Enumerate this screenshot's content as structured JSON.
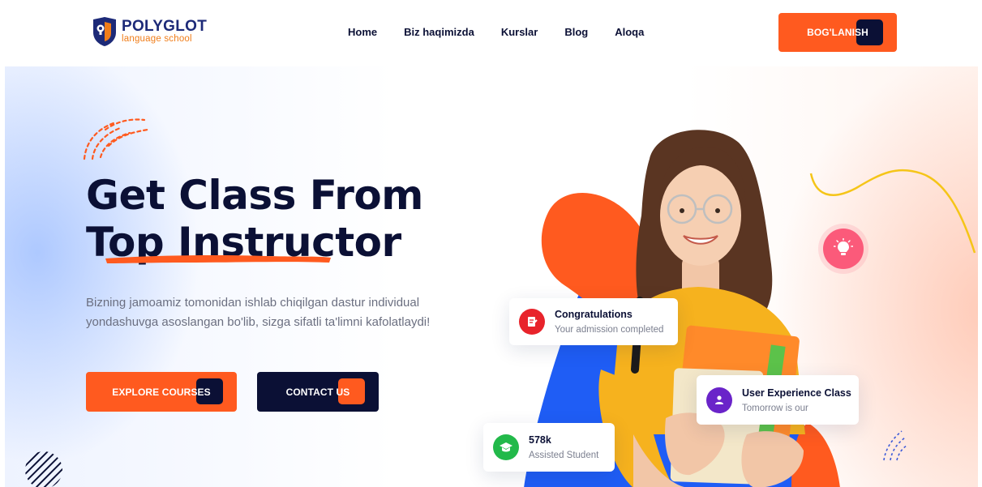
{
  "brand": {
    "name": "POLYGLOT",
    "tagline": "language school",
    "colors": {
      "primary": "#1d2a78",
      "accent": "#f07d19"
    }
  },
  "nav": {
    "items": [
      {
        "label": "Home"
      },
      {
        "label": "Biz haqimizda"
      },
      {
        "label": "Kurslar"
      },
      {
        "label": "Blog"
      },
      {
        "label": "Aloqa"
      }
    ],
    "cta_label": "BOG'LANISH"
  },
  "hero": {
    "title_line1": "Get Class From",
    "title_line2_prefix": "Top ",
    "title_line2_highlight": "Instructor",
    "description": "Bizning jamoamiz tomonidan ishlab chiqilgan dastur individual yondashuvga asoslangan bo'lib, sizga sifatli ta'limni kafolatlaydi!",
    "primary_button": "EXPLORE COURSES",
    "secondary_button": "CONTACT US"
  },
  "cards": {
    "admission": {
      "title": "Congratulations",
      "subtitle": "Your admission completed",
      "icon": "document-icon",
      "color": "#e8232b"
    },
    "ux_class": {
      "title": "User Experience Class",
      "subtitle": "Tomorrow is our",
      "icon": "user-class-icon",
      "color": "#6a24c9"
    },
    "students": {
      "title": "578k",
      "subtitle": "Assisted Student",
      "icon": "graduation-cap-icon",
      "color": "#22b94a"
    }
  },
  "colors": {
    "orange": "#ff5a1f",
    "navy": "#0b1035",
    "blue_blob": "#1f5df5",
    "yellow_line": "#f5c518",
    "bulb": "#fb5a7a"
  }
}
